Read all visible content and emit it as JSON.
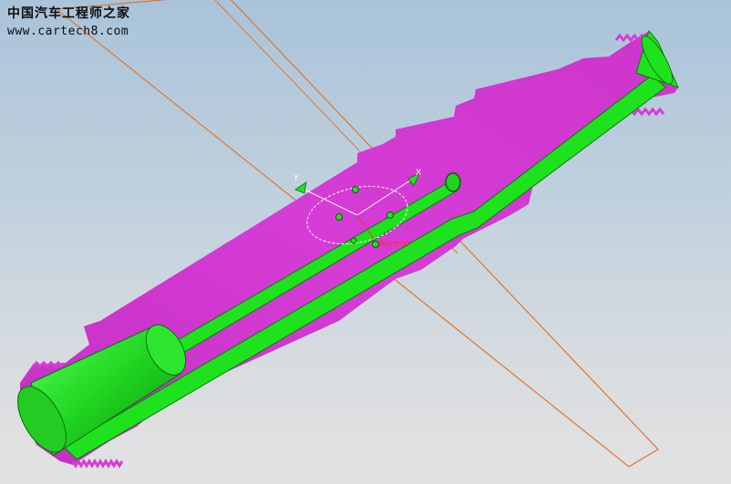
{
  "watermark": {
    "chinese": "中国汽车工程师之家",
    "url": "www.cartech8.com"
  },
  "manipulator": {
    "y_axis_label": "Y",
    "x_axis_label": "X",
    "normal_label": "Normal"
  },
  "colors": {
    "background_top": "#a9c3d9",
    "background_bottom": "#e2e2e2",
    "part_body": "#d63cd6",
    "channel": "#1fe21f",
    "section_plane": "#e0762c",
    "normal_label": "#ff2b2b"
  }
}
